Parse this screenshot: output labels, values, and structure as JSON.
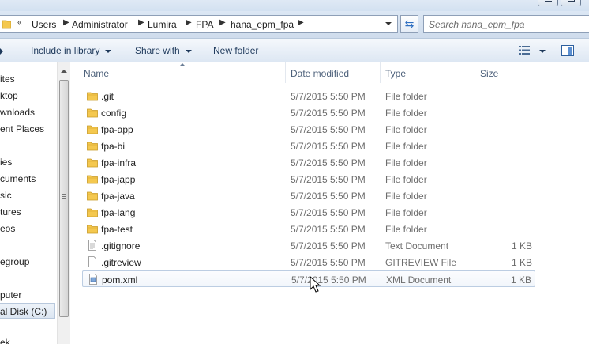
{
  "address_bar": {
    "overflow_marker": "«",
    "crumbs": [
      "Users",
      "Administrator",
      "Lumira",
      "FPA",
      "hana_epm_fpa"
    ],
    "refresh_icon": "refresh-arrows-icon"
  },
  "search": {
    "placeholder": "Search hana_epm_fpa"
  },
  "toolbar": {
    "include_in_library": "Include in library",
    "share_with": "Share with",
    "new_folder": "New folder",
    "view_icon": "details-view-icon",
    "preview_pane_icon": "preview-pane-icon"
  },
  "nav_pane": {
    "items": [
      "ites",
      "ktop",
      "wnloads",
      "ent Places",
      "ies",
      "cuments",
      "sic",
      "tures",
      "eos",
      "egroup",
      "puter",
      "al Disk (C:)",
      "ek"
    ],
    "selected_index": 11
  },
  "columns": {
    "name": "Name",
    "date": "Date modified",
    "type": "Type",
    "size": "Size"
  },
  "files": [
    {
      "name": ".git",
      "date": "5/7/2015 5:50 PM",
      "type": "File folder",
      "size": "",
      "icon": "folder-icon"
    },
    {
      "name": "config",
      "date": "5/7/2015 5:50 PM",
      "type": "File folder",
      "size": "",
      "icon": "folder-icon"
    },
    {
      "name": "fpa-app",
      "date": "5/7/2015 5:50 PM",
      "type": "File folder",
      "size": "",
      "icon": "folder-icon"
    },
    {
      "name": "fpa-bi",
      "date": "5/7/2015 5:50 PM",
      "type": "File folder",
      "size": "",
      "icon": "folder-icon"
    },
    {
      "name": "fpa-infra",
      "date": "5/7/2015 5:50 PM",
      "type": "File folder",
      "size": "",
      "icon": "folder-icon"
    },
    {
      "name": "fpa-japp",
      "date": "5/7/2015 5:50 PM",
      "type": "File folder",
      "size": "",
      "icon": "folder-icon"
    },
    {
      "name": "fpa-java",
      "date": "5/7/2015 5:50 PM",
      "type": "File folder",
      "size": "",
      "icon": "folder-icon"
    },
    {
      "name": "fpa-lang",
      "date": "5/7/2015 5:50 PM",
      "type": "File folder",
      "size": "",
      "icon": "folder-icon"
    },
    {
      "name": "fpa-test",
      "date": "5/7/2015 5:50 PM",
      "type": "File folder",
      "size": "",
      "icon": "folder-icon"
    },
    {
      "name": ".gitignore",
      "date": "5/7/2015 5:50 PM",
      "type": "Text Document",
      "size": "1 KB",
      "icon": "text-file-icon"
    },
    {
      "name": ".gitreview",
      "date": "5/7/2015 5:50 PM",
      "type": "GITREVIEW File",
      "size": "1 KB",
      "icon": "generic-file-icon"
    },
    {
      "name": "pom.xml",
      "date": "5/7/2015 5:50 PM",
      "type": "XML Document",
      "size": "1 KB",
      "icon": "xml-file-icon"
    }
  ],
  "hovered_row": 11,
  "colors": {
    "folder": "#f4c84f",
    "toolbar_text": "#1e395b",
    "secondary_text": "#6d6d6d",
    "accent": "#2f6fc1"
  }
}
